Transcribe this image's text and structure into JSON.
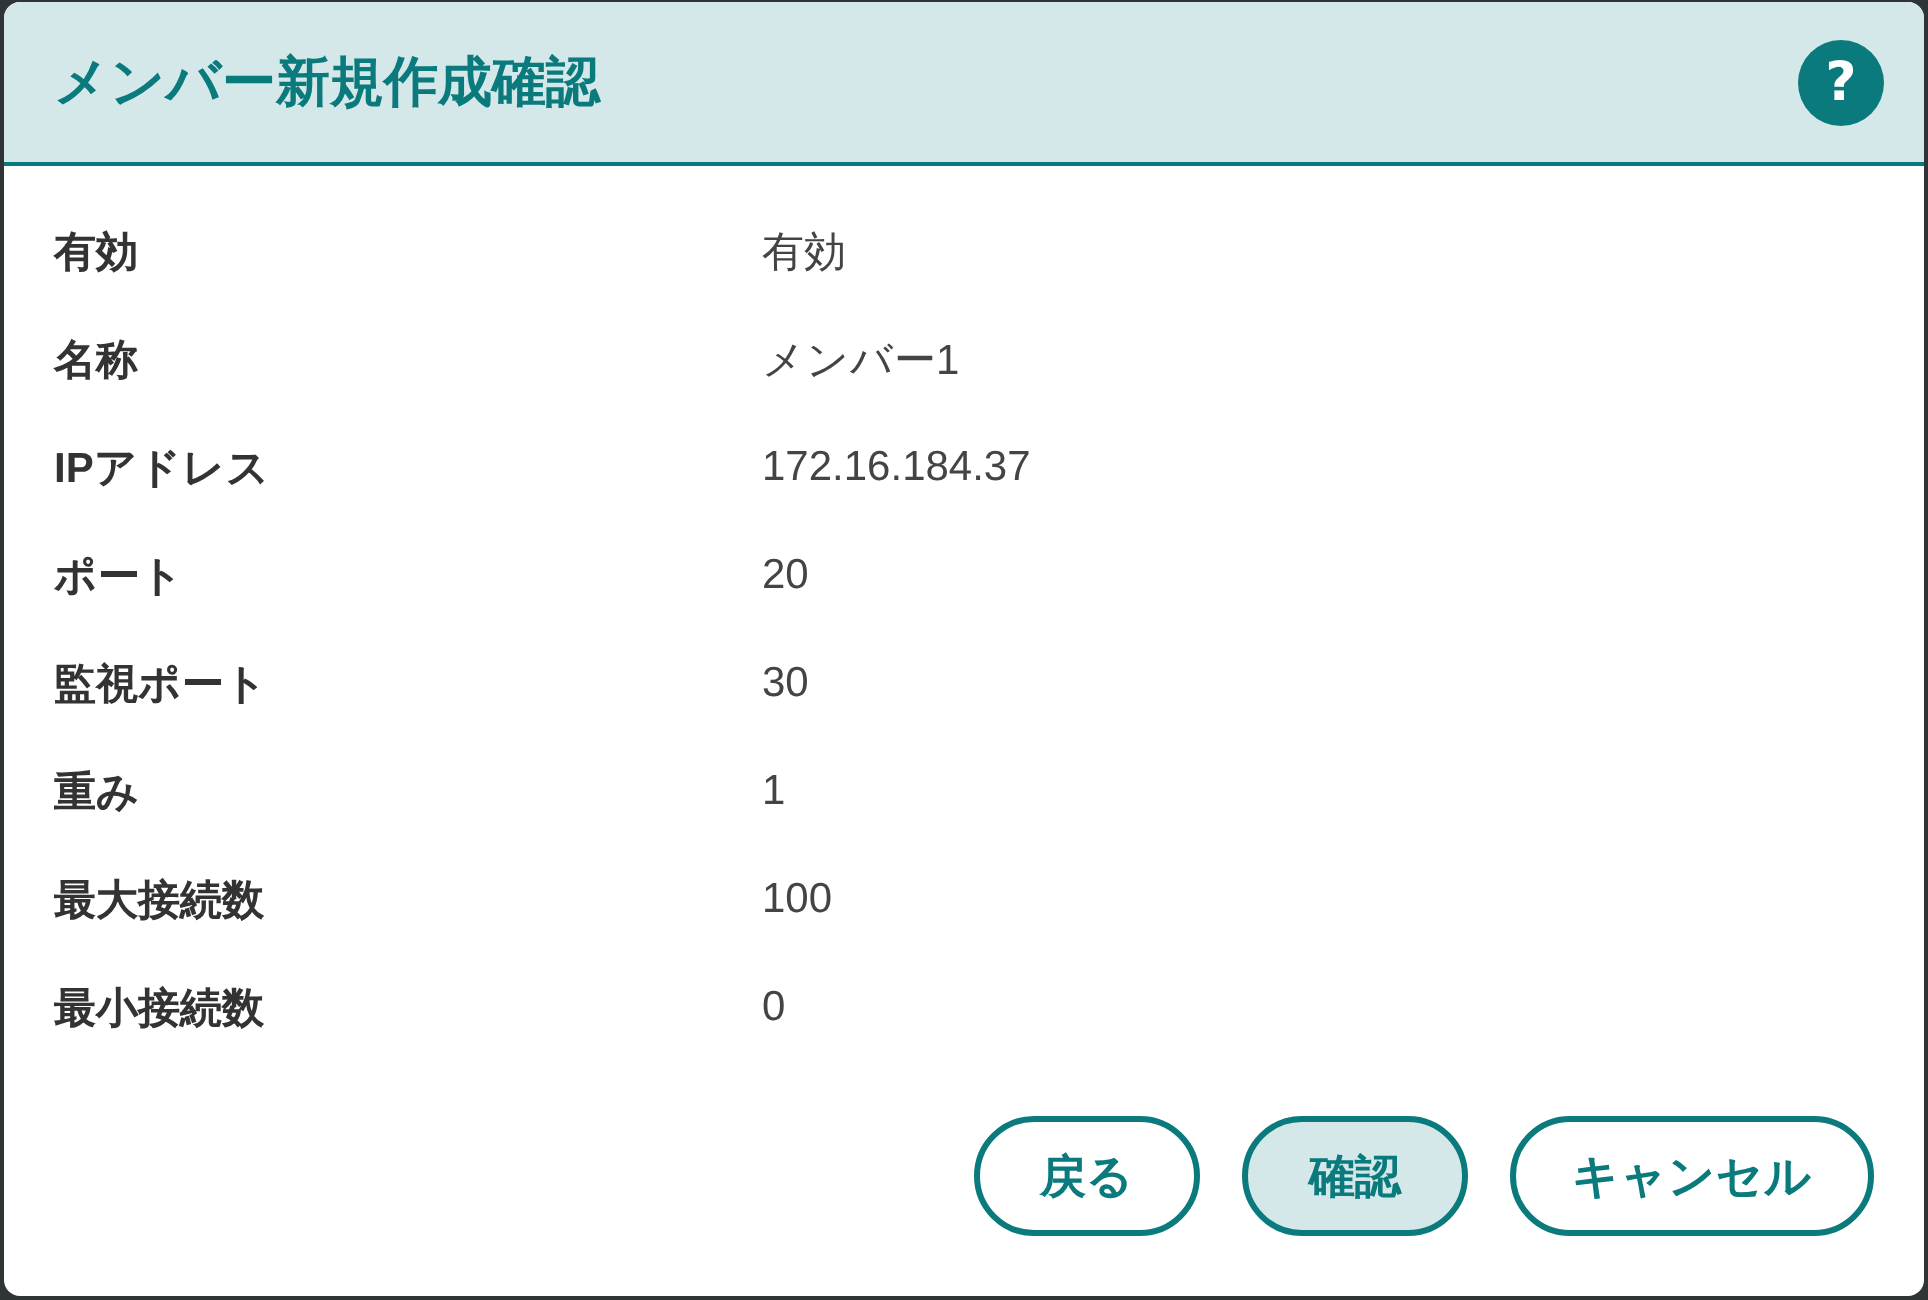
{
  "dialog": {
    "title": "メンバー新規作成確認",
    "help_button": {
      "label": "?"
    }
  },
  "fields": [
    {
      "label": "有効",
      "value": "有効"
    },
    {
      "label": "名称",
      "value": "メンバー1"
    },
    {
      "label": "IPアドレス",
      "value": "172.16.184.37"
    },
    {
      "label": "ポート",
      "value": "20"
    },
    {
      "label": "監視ポート",
      "value": "30"
    },
    {
      "label": "重み",
      "value": "1"
    },
    {
      "label": "最大接続数",
      "value": "100"
    },
    {
      "label": "最小接続数",
      "value": "0"
    }
  ],
  "buttons": [
    {
      "label": "戻る",
      "kind": "secondary"
    },
    {
      "label": "確認",
      "kind": "primary"
    },
    {
      "label": "キャンセル",
      "kind": "secondary"
    }
  ]
}
